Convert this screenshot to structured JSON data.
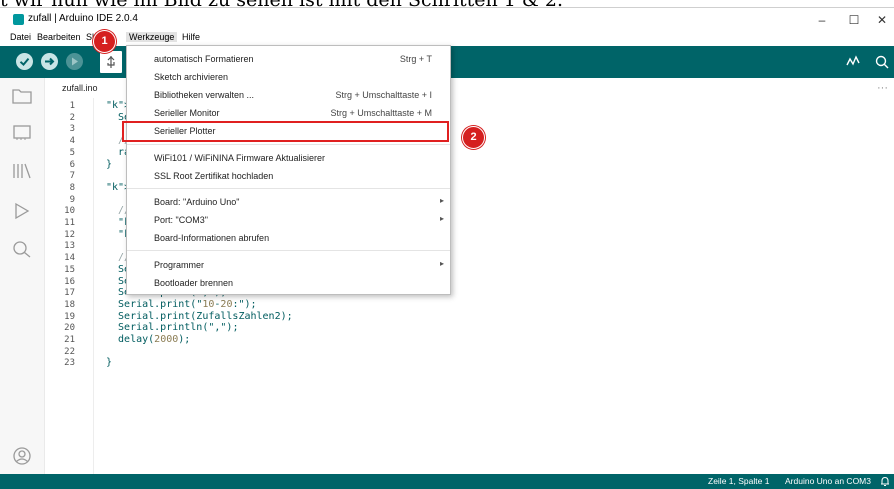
{
  "caption": "t wir nun wie im Bild zu sehen ist mit den Schritten 1 & 2.",
  "window": {
    "title": "zufall | Arduino IDE 2.0.4",
    "minimize": "–",
    "maximize": "☐",
    "close": "✕"
  },
  "menubar": [
    "Datei",
    "Bearbeiten",
    "Sketch",
    "Werkzeuge",
    "Hilfe"
  ],
  "tab": {
    "name": "zufall.ino"
  },
  "code": [
    {
      "n": "1",
      "t": "void setup() {"
    },
    {
      "n": "2",
      "t": "  Serial.begin(9600);"
    },
    {
      "n": "3",
      "t": ""
    },
    {
      "n": "4",
      "t": "  // Zufallsgenerator starten"
    },
    {
      "n": "5",
      "t": "  randomSeed(analogRead(A0));"
    },
    {
      "n": "6",
      "t": "}"
    },
    {
      "n": "7",
      "t": ""
    },
    {
      "n": "8",
      "t": "void loop() {"
    },
    {
      "n": "9",
      "t": ""
    },
    {
      "n": "10",
      "t": "  // Zufallszahlen bestimmen"
    },
    {
      "n": "11",
      "t": "  int ZufallsZahlen1 = random(1, 11);"
    },
    {
      "n": "12",
      "t": "  int ZufallsZahlen2 = random(10, 21);"
    },
    {
      "n": "13",
      "t": ""
    },
    {
      "n": "14",
      "t": "  // Werte schreiben"
    },
    {
      "n": "15",
      "t": "  Serial.print(\"1-10:\");"
    },
    {
      "n": "16",
      "t": "  Serial.print(ZufallsZahlen1);"
    },
    {
      "n": "17",
      "t": "  Serial.print(\",\");"
    },
    {
      "n": "18",
      "t": "  Serial.print(\"10-20:\");"
    },
    {
      "n": "19",
      "t": "  Serial.print(ZufallsZahlen2);"
    },
    {
      "n": "20",
      "t": "  Serial.println(\",\");"
    },
    {
      "n": "21",
      "t": "  delay(2000);"
    },
    {
      "n": "22",
      "t": ""
    },
    {
      "n": "23",
      "t": "}"
    }
  ],
  "dropdown": {
    "items": [
      {
        "label": "automatisch Formatieren",
        "shortcut": "Strg + T"
      },
      {
        "label": "Sketch archivieren",
        "shortcut": ""
      },
      {
        "label": "Bibliotheken verwalten ...",
        "shortcut": "Strg + Umschalttaste + I"
      },
      {
        "label": "Serieller Monitor",
        "shortcut": "Strg + Umschalttaste + M"
      },
      {
        "label": "Serieller Plotter",
        "shortcut": ""
      },
      {
        "label": "WiFi101 / WiFiNINA Firmware Aktualisierer",
        "shortcut": ""
      },
      {
        "label": "SSL Root Zertifikat hochladen",
        "shortcut": ""
      },
      {
        "label": "Board: \"Arduino Uno\"",
        "shortcut": ""
      },
      {
        "label": "Port: \"COM3\"",
        "shortcut": ""
      },
      {
        "label": "Board-Informationen abrufen",
        "shortcut": ""
      },
      {
        "label": "Programmer",
        "shortcut": ""
      },
      {
        "label": "Bootloader brennen",
        "shortcut": ""
      }
    ],
    "submenu_arrow": "▸"
  },
  "annotations": {
    "step1": "1",
    "step2": "2"
  },
  "statusbar": {
    "position": "Zeile 1, Spalte 1",
    "board": "Arduino Uno an COM3"
  },
  "icons": {
    "verify": "check-icon",
    "upload": "arrow-right-icon",
    "debug": "debug-icon",
    "usb": "usb-icon",
    "serial_plotter": "plotter-icon",
    "serial_monitor": "monitor-icon",
    "sidebar": [
      "folder-icon",
      "board-icon",
      "library-icon",
      "debug-icon",
      "search-icon",
      "account-icon"
    ],
    "bell": "bell-icon"
  },
  "colors": {
    "toolbar": "#006468",
    "accent": "#00979d",
    "highlight": "#e02020"
  }
}
